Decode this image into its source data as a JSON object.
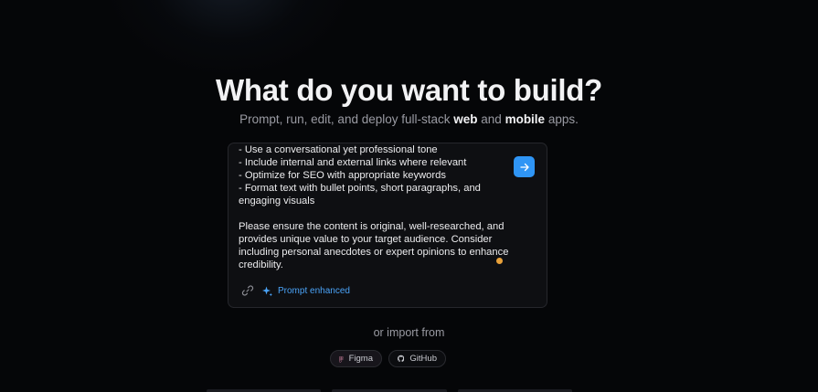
{
  "hero": {
    "title": "What do you want to build?",
    "subtitle_prefix": "Prompt, run, edit, and deploy full-stack ",
    "subtitle_web": "web",
    "subtitle_and": " and ",
    "subtitle_mobile": "mobile",
    "subtitle_suffix": " apps."
  },
  "prompt": {
    "text": "- Use a conversational yet professional tone\n- Include internal and external links where relevant\n- Optimize for SEO with appropriate keywords\n- Format text with bullet points, short paragraphs, and engaging visuals\n\nPlease ensure the content is original, well-researched, and provides unique value to your target audience. Consider including personal anecdotes or expert opinions to enhance credibility.",
    "enhance_label": "Prompt enhanced",
    "send_icon": "arrow-right-icon",
    "link_icon": "link-icon",
    "enhance_icon": "sparkle-icon",
    "accent_color": "#2f95f5"
  },
  "import": {
    "label": "or import from",
    "sources": [
      {
        "label": "Figma",
        "icon": "figma-icon"
      },
      {
        "label": "GitHub",
        "icon": "github-icon"
      }
    ]
  }
}
